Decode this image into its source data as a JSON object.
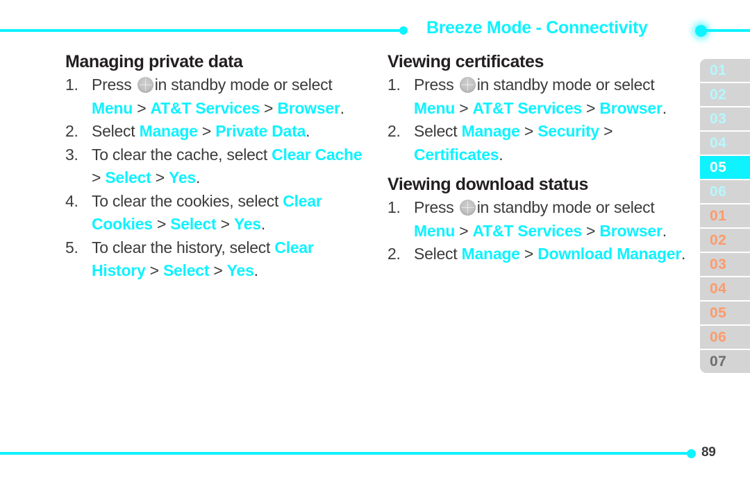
{
  "header": {
    "title": "Breeze Mode - Connectivity",
    "accent_color": "#0ff2ff",
    "left_rule": "",
    "right_rule": ""
  },
  "icons": {
    "nav_key": "navigation-key-icon"
  },
  "columns": {
    "left": [
      {
        "title": "Managing private data",
        "steps": [
          {
            "num": "1.",
            "parts": [
              {
                "t": "Press ",
                "s": "plain"
              },
              {
                "t": "",
                "s": "navkey"
              },
              {
                "t": "in standby mode or select ",
                "s": "plain"
              },
              {
                "t": "Menu",
                "s": "hl"
              },
              {
                "t": " > ",
                "s": "sep"
              },
              {
                "t": "AT&T Services",
                "s": "hl"
              },
              {
                "t": " > ",
                "s": "sep"
              },
              {
                "t": "Browser",
                "s": "hl"
              },
              {
                "t": ".",
                "s": "plain"
              }
            ]
          },
          {
            "num": "2.",
            "parts": [
              {
                "t": "Select ",
                "s": "plain"
              },
              {
                "t": "Manage",
                "s": "hl"
              },
              {
                "t": " > ",
                "s": "sep"
              },
              {
                "t": "Private Data",
                "s": "hl"
              },
              {
                "t": ".",
                "s": "plain"
              }
            ]
          },
          {
            "num": "3.",
            "parts": [
              {
                "t": "To clear the cache, select ",
                "s": "plain"
              },
              {
                "t": "Clear Cache",
                "s": "hl"
              },
              {
                "t": " > ",
                "s": "sep"
              },
              {
                "t": "Select",
                "s": "hl"
              },
              {
                "t": " > ",
                "s": "sep"
              },
              {
                "t": "Yes",
                "s": "hl"
              },
              {
                "t": ".",
                "s": "plain"
              }
            ]
          },
          {
            "num": "4.",
            "parts": [
              {
                "t": "To clear the cookies, select ",
                "s": "plain"
              },
              {
                "t": "Clear Cookies",
                "s": "hl"
              },
              {
                "t": " > ",
                "s": "sep"
              },
              {
                "t": "Select",
                "s": "hl"
              },
              {
                "t": " > ",
                "s": "sep"
              },
              {
                "t": "Yes",
                "s": "hl"
              },
              {
                "t": ".",
                "s": "plain"
              }
            ]
          },
          {
            "num": "5.",
            "parts": [
              {
                "t": "To clear the history, select ",
                "s": "plain"
              },
              {
                "t": "Clear History",
                "s": "hl"
              },
              {
                "t": " > ",
                "s": "sep"
              },
              {
                "t": "Select",
                "s": "hl"
              },
              {
                "t": " > ",
                "s": "sep"
              },
              {
                "t": "Yes",
                "s": "hl"
              },
              {
                "t": ".",
                "s": "plain"
              }
            ]
          }
        ]
      }
    ],
    "right": [
      {
        "title": "Viewing certificates",
        "steps": [
          {
            "num": "1.",
            "parts": [
              {
                "t": "Press ",
                "s": "plain"
              },
              {
                "t": "",
                "s": "navkey"
              },
              {
                "t": "in standby mode or select ",
                "s": "plain"
              },
              {
                "t": "Menu",
                "s": "hl"
              },
              {
                "t": " > ",
                "s": "sep"
              },
              {
                "t": "AT&T Services",
                "s": "hl"
              },
              {
                "t": " > ",
                "s": "sep"
              },
              {
                "t": "Browser",
                "s": "hl"
              },
              {
                "t": ".",
                "s": "plain"
              }
            ]
          },
          {
            "num": "2.",
            "parts": [
              {
                "t": "Select ",
                "s": "plain"
              },
              {
                "t": "Manage",
                "s": "hl"
              },
              {
                "t": " > ",
                "s": "sep"
              },
              {
                "t": "Security",
                "s": "hl"
              },
              {
                "t": " > ",
                "s": "sep"
              },
              {
                "t": "Certificates",
                "s": "hl"
              },
              {
                "t": ".",
                "s": "plain"
              }
            ]
          }
        ]
      },
      {
        "title": "Viewing download status",
        "steps": [
          {
            "num": "1.",
            "parts": [
              {
                "t": "Press ",
                "s": "plain"
              },
              {
                "t": "",
                "s": "navkey"
              },
              {
                "t": "in standby mode or select ",
                "s": "plain"
              },
              {
                "t": "Menu",
                "s": "hl"
              },
              {
                "t": " > ",
                "s": "sep"
              },
              {
                "t": "AT&T Services",
                "s": "hl"
              },
              {
                "t": " > ",
                "s": "sep"
              },
              {
                "t": "Browser",
                "s": "hl"
              },
              {
                "t": ".",
                "s": "plain"
              }
            ]
          },
          {
            "num": "2.",
            "parts": [
              {
                "t": "Select ",
                "s": "plain"
              },
              {
                "t": "Manage",
                "s": "hl"
              },
              {
                "t": " > ",
                "s": "sep"
              },
              {
                "t": "Download Manager",
                "s": "hl"
              },
              {
                "t": ".",
                "s": "plain"
              }
            ]
          }
        ]
      }
    ]
  },
  "tabstrip": {
    "active_index": 4,
    "tabs": [
      {
        "label": "01",
        "style": "cyan"
      },
      {
        "label": "02",
        "style": "cyan"
      },
      {
        "label": "03",
        "style": "cyan"
      },
      {
        "label": "04",
        "style": "cyan"
      },
      {
        "label": "05",
        "style": "active"
      },
      {
        "label": "06",
        "style": "cyan"
      },
      {
        "label": "01",
        "style": "orange"
      },
      {
        "label": "02",
        "style": "orange"
      },
      {
        "label": "03",
        "style": "orange"
      },
      {
        "label": "04",
        "style": "orange"
      },
      {
        "label": "05",
        "style": "orange"
      },
      {
        "label": "06",
        "style": "orange"
      },
      {
        "label": "07",
        "style": "plain"
      }
    ]
  },
  "footer": {
    "page_number": "89"
  }
}
